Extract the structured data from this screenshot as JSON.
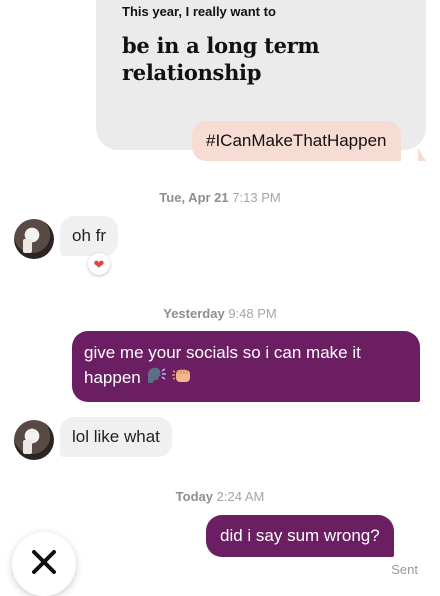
{
  "prompt": {
    "label": "This year, I really want to",
    "answer_line1": "be in a long term",
    "answer_line2": "relationship"
  },
  "prompt_reply": "#ICanMakeThatHappen",
  "timestamps": [
    {
      "day": "Tue, Apr 21",
      "time": "7:13 PM"
    },
    {
      "day": "Yesterday",
      "time": "9:48 PM"
    },
    {
      "day": "Today",
      "time": "2:24 AM"
    }
  ],
  "messages": [
    {
      "text": "oh fr",
      "reaction": "heart-icon"
    },
    {
      "line1": "give me your socials so i can make it",
      "line2": "happen"
    },
    {
      "text": "lol like what"
    },
    {
      "text": "did i say sum wrong?"
    }
  ],
  "status": "Sent",
  "colors": {
    "outgoing_bubble": "#6b1f62",
    "incoming_bubble": "#f0f0f0",
    "prompt_reply_bubble": "#f6dcd3",
    "heart": "#d84848"
  }
}
